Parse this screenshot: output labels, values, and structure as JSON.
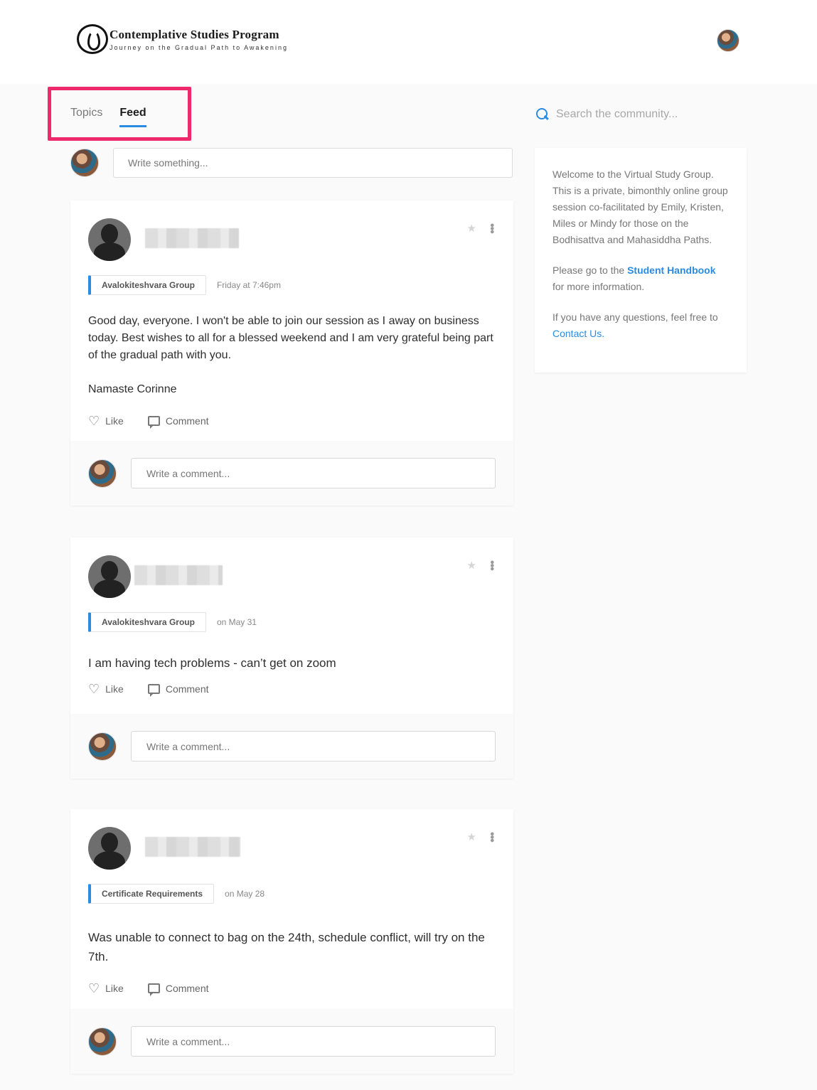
{
  "header": {
    "logo_title": "Contemplative Studies Program",
    "logo_subtitle": "Journey on the Gradual Path to Awakening",
    "user_avatar_icon": "user-avatar"
  },
  "tabs": [
    {
      "label": "Topics",
      "active": false
    },
    {
      "label": "Feed",
      "active": true
    }
  ],
  "search": {
    "placeholder": "Search the community..."
  },
  "composer": {
    "placeholder": "Write something..."
  },
  "posts": [
    {
      "group": "Avalokiteshvara Group",
      "time": "Friday at 7:46pm",
      "body": [
        "Good day, everyone.  I won't be able to join our session as I away on business today.  Best wishes to all for a blessed weekend and I am very grateful being part of the gradual path with you.",
        "Namaste Corinne"
      ],
      "like_label": "Like",
      "comment_label": "Comment",
      "comment_placeholder": "Write a comment..."
    },
    {
      "group": "Avalokiteshvara Group",
      "time": "on May 31",
      "body": [
        "I am having tech problems - can’t get on zoom"
      ],
      "like_label": "Like",
      "comment_label": "Comment",
      "comment_placeholder": "Write a comment..."
    },
    {
      "group": "Certificate Requirements",
      "time": "on May 28",
      "body": [
        "Was unable to connect to bag on the 24th, schedule conflict, will try on the 7th."
      ],
      "like_label": "Like",
      "comment_label": "Comment",
      "comment_placeholder": "Write a comment..."
    }
  ],
  "sidebar": {
    "welcome": "Welcome to the Virtual Study Group. This is a private, bimonthly online group session co-facilitated by Emily, Kristen, Miles or Mindy for those on the Bodhisattva and Mahasiddha Paths.",
    "handbook_prefix": "Please go to the ",
    "handbook_link": "Student Handbook",
    "handbook_suffix": " for more information.",
    "questions_prefix": "If you have any questions, feel free to ",
    "contact_link": "Contact Us",
    "contact_suffix": "."
  },
  "colors": {
    "accent": "#2a8be0",
    "highlight": "#ef2a6c"
  }
}
